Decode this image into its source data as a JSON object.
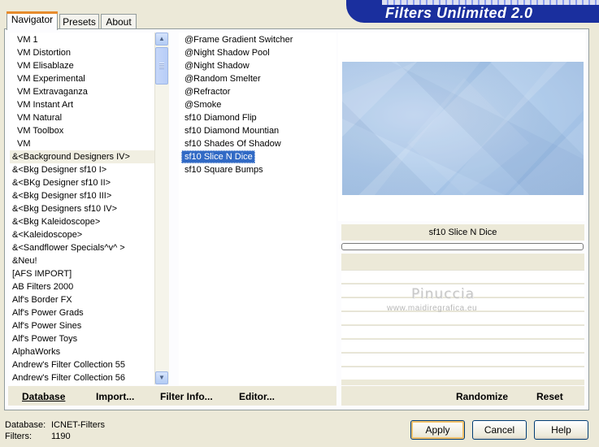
{
  "header": {
    "logo_text": "Filters Unlimited 2.0"
  },
  "tabs": [
    {
      "label": "Navigator",
      "active": true
    },
    {
      "label": "Presets",
      "active": false
    },
    {
      "label": "About",
      "active": false
    }
  ],
  "categories": {
    "selected": "&<Background Designers IV>",
    "items": [
      "VM 1",
      "VM Distortion",
      "VM Elisablaze",
      "VM Experimental",
      "VM Extravaganza",
      "VM Instant Art",
      "VM Natural",
      "VM Toolbox",
      "VM",
      "&<Background Designers IV>",
      "&<Bkg Designer sf10 I>",
      "&<BKg Designer sf10 II>",
      "&<Bkg Designer sf10 III>",
      "&<Bkg Designers sf10 IV>",
      "&<Bkg Kaleidoscope>",
      "&<Kaleidoscope>",
      "&<Sandflower Specials^v^ >",
      "&Neu!",
      "[AFS IMPORT]",
      "AB Filters 2000",
      "Alf's Border FX",
      "Alf's Power Grads",
      "Alf's Power Sines",
      "Alf's Power Toys",
      "AlphaWorks",
      "Andrew's Filter Collection 55",
      "Andrew's Filter Collection 56"
    ]
  },
  "filters": {
    "selected": "sf10 Slice N Dice",
    "items": [
      "@Frame Gradient Switcher",
      "@Night Shadow Pool",
      "@Night Shadow",
      "@Random Smelter",
      "@Refractor",
      "@Smoke",
      "sf10 Diamond Flip",
      "sf10 Diamond Mountian",
      "sf10 Shades Of Shadow",
      "sf10 Slice N Dice",
      "sf10 Square Bumps"
    ]
  },
  "preview": {
    "filter_name": "sf10 Slice N Dice",
    "watermark_name": "Pinuccia",
    "watermark_site": "www.maidiregrafica.eu"
  },
  "bar_buttons": {
    "database": "Database",
    "import": "Import...",
    "filter_info": "Filter Info...",
    "editor": "Editor...",
    "randomize": "Randomize",
    "reset": "Reset"
  },
  "footer": {
    "database_label": "Database:",
    "database_value": "ICNET-Filters",
    "filters_label": "Filters:",
    "filters_value": "1190",
    "apply": "Apply",
    "cancel": "Cancel",
    "help": "Help"
  },
  "colors": {
    "dialog_bg": "#ece9d8",
    "selection_blue": "#316ac5",
    "logo_blue": "#1a2f9e"
  }
}
